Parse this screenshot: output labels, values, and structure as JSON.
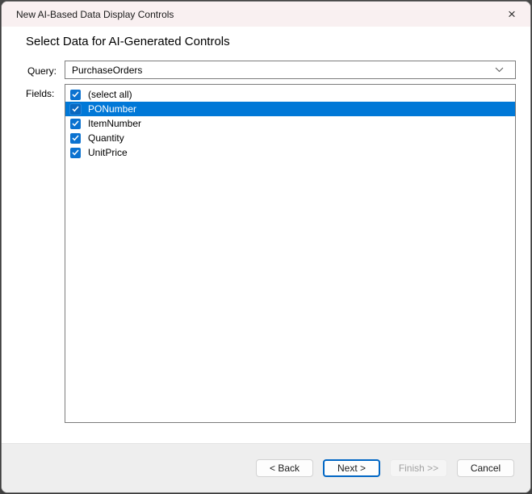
{
  "window": {
    "title": "New AI-Based Data Display Controls",
    "close_glyph": "×"
  },
  "heading": "Select Data for AI-Generated Controls",
  "query": {
    "label": "Query:",
    "value": "PurchaseOrders"
  },
  "fields": {
    "label": "Fields:",
    "items": [
      {
        "label": "(select all)",
        "checked": true,
        "selected": false
      },
      {
        "label": "PONumber",
        "checked": true,
        "selected": true
      },
      {
        "label": "ItemNumber",
        "checked": true,
        "selected": false
      },
      {
        "label": "Quantity",
        "checked": true,
        "selected": false
      },
      {
        "label": "UnitPrice",
        "checked": true,
        "selected": false
      }
    ]
  },
  "buttons": {
    "back": {
      "label": "< Back",
      "state": "enabled"
    },
    "next": {
      "label": "Next >",
      "state": "focused"
    },
    "finish": {
      "label": "Finish >>",
      "state": "disabled"
    },
    "cancel": {
      "label": "Cancel",
      "state": "enabled"
    }
  },
  "colors": {
    "selection_blue": "#0078d7",
    "checkbox_blue": "#0b72d0",
    "titlebar_pink": "#f9f0f1",
    "footer_gray": "#eeeeee",
    "focus_border_blue": "#0066c4"
  }
}
